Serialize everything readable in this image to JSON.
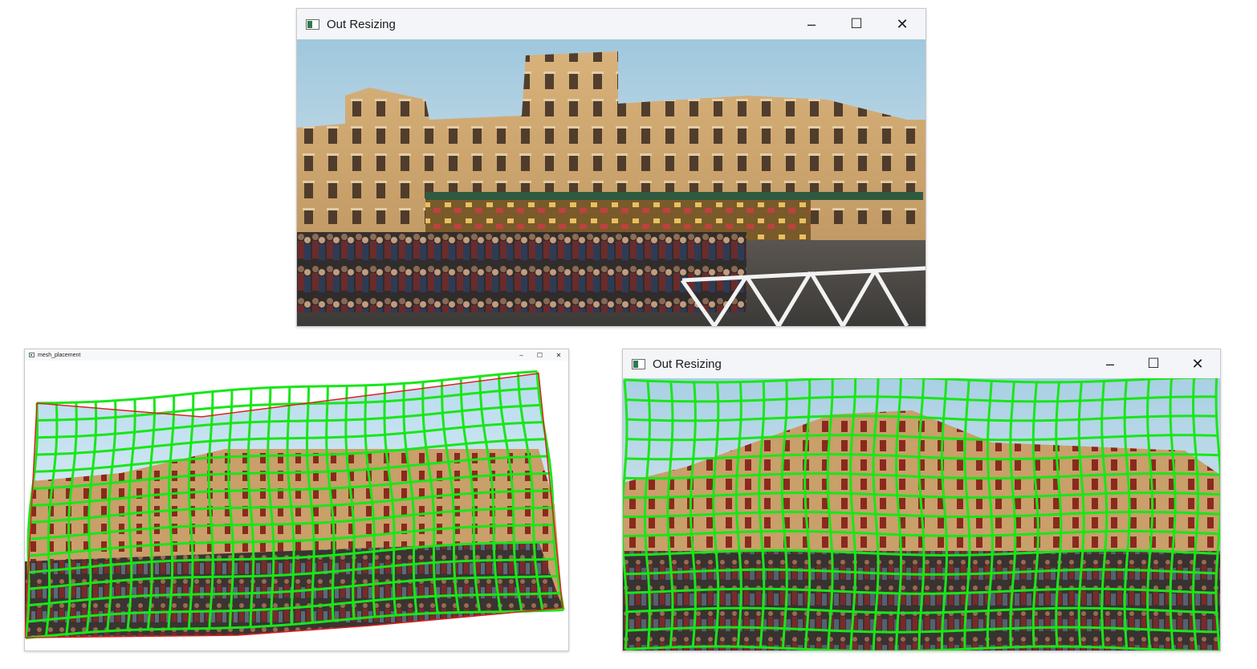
{
  "windows": [
    {
      "id": "top",
      "title": "Out Resizing",
      "minimize": "–",
      "maximize": "☐",
      "close": "✕"
    },
    {
      "id": "mesh",
      "title": "mesh_placement",
      "minimize": "–",
      "maximize": "☐",
      "close": "✕"
    },
    {
      "id": "bottom",
      "title": "Out Resizing",
      "minimize": "–",
      "maximize": "☐",
      "close": "✕"
    }
  ],
  "colors": {
    "mesh_line": "#19e619",
    "boundary_line": "#e02020",
    "sky": "#cfe3ee",
    "building": "#c9a36d",
    "ground": "#4a4a4a"
  },
  "icons": [
    "app-window-icon",
    "minimize-icon",
    "maximize-icon",
    "close-icon"
  ]
}
